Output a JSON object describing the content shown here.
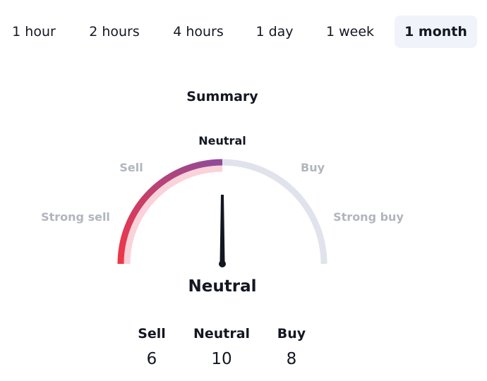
{
  "tabs": [
    {
      "label": "1 hour",
      "active": false
    },
    {
      "label": "2 hours",
      "active": false
    },
    {
      "label": "4 hours",
      "active": false
    },
    {
      "label": "1 day",
      "active": false
    },
    {
      "label": "1 week",
      "active": false
    },
    {
      "label": "1 month",
      "active": true
    }
  ],
  "summary": {
    "title": "Summary",
    "gauge_labels": {
      "strong_sell": "Strong sell",
      "sell": "Sell",
      "neutral": "Neutral",
      "buy": "Buy",
      "strong_buy": "Strong buy"
    },
    "result": "Neutral",
    "counts": [
      {
        "label": "Sell",
        "value": "6"
      },
      {
        "label": "Neutral",
        "value": "10"
      },
      {
        "label": "Buy",
        "value": "8"
      }
    ]
  },
  "colors": {
    "sell": "#f23645",
    "neutral_purple": "#8e4b9a",
    "track": "#e0e3eb",
    "needle": "#131722",
    "active_tab": "#f0f3fa"
  }
}
